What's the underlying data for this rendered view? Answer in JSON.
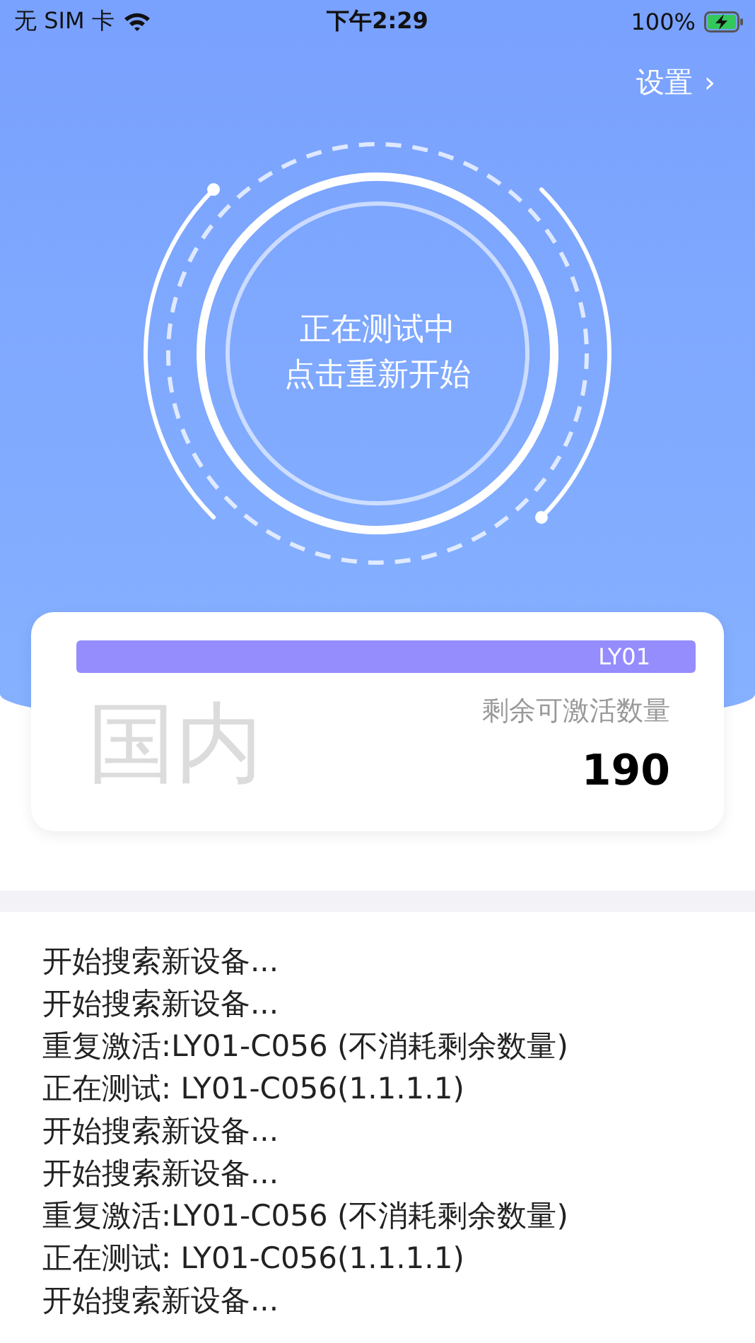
{
  "status_bar": {
    "carrier": "无 SIM 卡",
    "time": "下午2:29",
    "battery": "100%"
  },
  "settings_link": {
    "label": "设置",
    "chevron": "›"
  },
  "test_ring": {
    "lines": [
      "正在测试中",
      "点击重新开始"
    ]
  },
  "quota_card": {
    "tag": "LY01",
    "region": "国内",
    "label": "剩余可激活数量",
    "count": "190"
  },
  "log": [
    "开始搜索新设备...",
    "开始搜索新设备...",
    "重复激活:LY01-C056 (不消耗剩余数量)",
    "正在测试: LY01-C056(1.1.1.1)",
    "开始搜索新设备...",
    "开始搜索新设备...",
    "重复激活:LY01-C056 (不消耗剩余数量)",
    "正在测试: LY01-C056(1.1.1.1)",
    "开始搜索新设备..."
  ]
}
